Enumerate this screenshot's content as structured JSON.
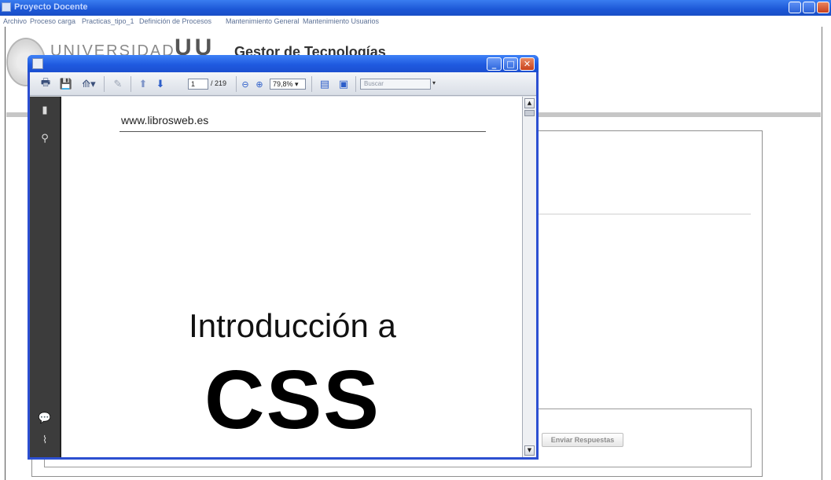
{
  "app": {
    "title": "Proyecto Docente"
  },
  "menubar": {
    "items": [
      "Archivo",
      "Proceso carga",
      "Practicas_tipo_1",
      "Definición de Procesos",
      "Mantenimiento General",
      "Mantenimiento Usuarios"
    ]
  },
  "header": {
    "logo_text": "UNIVERSIDAD",
    "logo_mark": "UU",
    "title": "Gestor de Tecnologías"
  },
  "main": {
    "send_button": "Enviar Respuestas"
  },
  "pdf": {
    "toolbar": {
      "page_current": "1",
      "page_total": "/ 219",
      "zoom": "79,8%",
      "search_placeholder": "Buscar"
    },
    "page": {
      "url": "www.librosweb.es",
      "heading": "Introducción a",
      "title": "CSS"
    },
    "icons": {
      "print": "printer-icon",
      "save": "floppy-disk-icon",
      "share": "share-icon",
      "comment": "comment-icon",
      "prev": "arrow-up-icon",
      "next": "arrow-down-icon",
      "zoom_out": "zoom-out-icon",
      "zoom_in": "zoom-in-icon",
      "fit_page": "fit-page-icon",
      "fit_width": "fit-width-icon"
    }
  },
  "colors": {
    "titlebar": "#1f5ae0",
    "close": "#c9421c",
    "sidebar": "#3c3c3c"
  }
}
